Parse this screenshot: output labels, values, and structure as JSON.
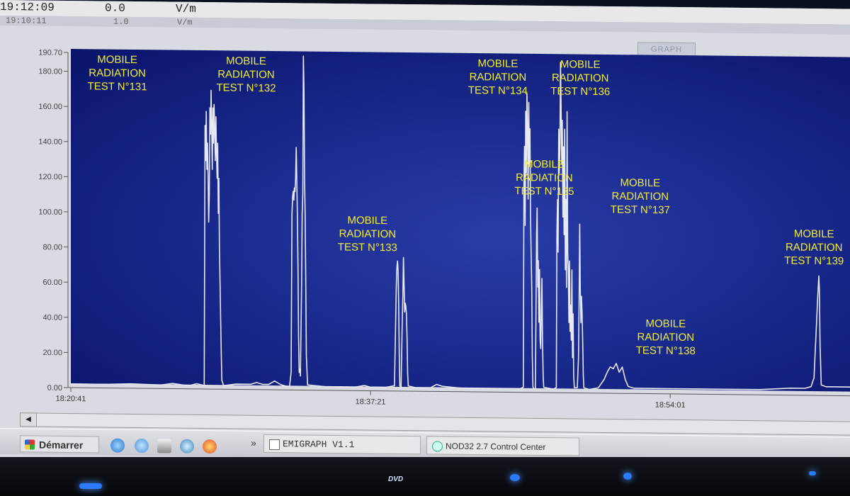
{
  "status": {
    "time": "19:12:09",
    "value": "0.0",
    "unit": "V/m",
    "shadow_time": "19:10:11",
    "shadow_value": "1.0",
    "shadow_unit": "V/m"
  },
  "graph_tab": "GRAPH",
  "colors": {
    "plot_background": "#1a2a8e",
    "trace": "#e6e8f2",
    "annotation": "#f2ef30"
  },
  "chart_data": {
    "type": "line",
    "xlabel": "",
    "ylabel": "",
    "ylim": [
      0,
      190.7
    ],
    "yticks": [
      "0.00",
      "20.00",
      "40.00",
      "60.00",
      "80.00",
      "100.00",
      "120.00",
      "140.00",
      "160.00",
      "180.00",
      "190.70"
    ],
    "xticks": [
      {
        "label": "18:20:41",
        "value": 0
      },
      {
        "label": "18:37:21",
        "value": 1000
      },
      {
        "label": "18:54:01",
        "value": 2000
      }
    ],
    "series": [
      {
        "points": [
          [
            0,
            2
          ],
          [
            100,
            2
          ],
          [
            200,
            2.5
          ],
          [
            300,
            2
          ],
          [
            340,
            3
          ],
          [
            380,
            2
          ],
          [
            400,
            2
          ],
          [
            420,
            3
          ],
          [
            445,
            2
          ],
          [
            448,
            150
          ],
          [
            450,
            130
          ],
          [
            452,
            158
          ],
          [
            454,
            125
          ],
          [
            456,
            140
          ],
          [
            458,
            120
          ],
          [
            460,
            95
          ],
          [
            462,
            110
          ],
          [
            464,
            160
          ],
          [
            466,
            145
          ],
          [
            468,
            170
          ],
          [
            470,
            150
          ],
          [
            472,
            125
          ],
          [
            474,
            160
          ],
          [
            476,
            140
          ],
          [
            478,
            162
          ],
          [
            480,
            148
          ],
          [
            482,
            130
          ],
          [
            484,
            155
          ],
          [
            486,
            135
          ],
          [
            488,
            120
          ],
          [
            490,
            140
          ],
          [
            492,
            100
          ],
          [
            494,
            120
          ],
          [
            496,
            80
          ],
          [
            498,
            60
          ],
          [
            500,
            40
          ],
          [
            502,
            20
          ],
          [
            504,
            5
          ],
          [
            510,
            2
          ],
          [
            550,
            3
          ],
          [
            600,
            3
          ],
          [
            620,
            4
          ],
          [
            640,
            3
          ],
          [
            660,
            3
          ],
          [
            680,
            5
          ],
          [
            700,
            3
          ],
          [
            720,
            2
          ],
          [
            730,
            2
          ],
          [
            735,
            10
          ],
          [
            738,
            100
          ],
          [
            740,
            110
          ],
          [
            742,
            113
          ],
          [
            744,
            108
          ],
          [
            746,
            115
          ],
          [
            748,
            113
          ],
          [
            750,
            120
          ],
          [
            752,
            138
          ],
          [
            754,
            120
          ],
          [
            756,
            100
          ],
          [
            758,
            70
          ],
          [
            760,
            30
          ],
          [
            762,
            10
          ],
          [
            764,
            12
          ],
          [
            766,
            8
          ],
          [
            770,
            60
          ],
          [
            772,
            100
          ],
          [
            774,
            112
          ],
          [
            776,
            190
          ],
          [
            778,
            170
          ],
          [
            780,
            120
          ],
          [
            782,
            100
          ],
          [
            784,
            60
          ],
          [
            786,
            20
          ],
          [
            790,
            3
          ],
          [
            850,
            2
          ],
          [
            900,
            2
          ],
          [
            950,
            2
          ],
          [
            980,
            3
          ],
          [
            1000,
            2
          ],
          [
            1050,
            2
          ],
          [
            1080,
            3
          ],
          [
            1084,
            40
          ],
          [
            1086,
            60
          ],
          [
            1088,
            70
          ],
          [
            1090,
            74
          ],
          [
            1092,
            68
          ],
          [
            1094,
            50
          ],
          [
            1096,
            20
          ],
          [
            1098,
            3
          ],
          [
            1102,
            2
          ],
          [
            1106,
            40
          ],
          [
            1108,
            55
          ],
          [
            1110,
            76
          ],
          [
            1112,
            60
          ],
          [
            1114,
            45
          ],
          [
            1116,
            50
          ],
          [
            1118,
            48
          ],
          [
            1120,
            44
          ],
          [
            1122,
            30
          ],
          [
            1124,
            10
          ],
          [
            1126,
            3
          ],
          [
            1150,
            2
          ],
          [
            1200,
            2
          ],
          [
            1220,
            4
          ],
          [
            1240,
            3
          ],
          [
            1300,
            2
          ],
          [
            1400,
            2
          ],
          [
            1450,
            2
          ],
          [
            1500,
            2
          ],
          [
            1510,
            3
          ],
          [
            1512,
            120
          ],
          [
            1514,
            140
          ],
          [
            1516,
            95
          ],
          [
            1518,
            160
          ],
          [
            1520,
            125
          ],
          [
            1522,
            170
          ],
          [
            1524,
            150
          ],
          [
            1526,
            110
          ],
          [
            1528,
            165
          ],
          [
            1530,
            130
          ],
          [
            1532,
            150
          ],
          [
            1534,
            100
          ],
          [
            1536,
            80
          ],
          [
            1538,
            60
          ],
          [
            1540,
            20
          ],
          [
            1542,
            3
          ],
          [
            1546,
            2
          ],
          [
            1550,
            2
          ],
          [
            1552,
            40
          ],
          [
            1554,
            90
          ],
          [
            1556,
            105
          ],
          [
            1558,
            60
          ],
          [
            1560,
            75
          ],
          [
            1562,
            40
          ],
          [
            1564,
            70
          ],
          [
            1566,
            30
          ],
          [
            1568,
            25
          ],
          [
            1570,
            45
          ],
          [
            1572,
            65
          ],
          [
            1574,
            30
          ],
          [
            1576,
            10
          ],
          [
            1578,
            3
          ],
          [
            1610,
            2
          ],
          [
            1620,
            3
          ],
          [
            1622,
            90
          ],
          [
            1624,
            110
          ],
          [
            1626,
            80
          ],
          [
            1628,
            150
          ],
          [
            1630,
            125
          ],
          [
            1632,
            140
          ],
          [
            1634,
            188
          ],
          [
            1636,
            160
          ],
          [
            1638,
            130
          ],
          [
            1640,
            155
          ],
          [
            1642,
            100
          ],
          [
            1644,
            140
          ],
          [
            1646,
            90
          ],
          [
            1648,
            150
          ],
          [
            1650,
            70
          ],
          [
            1652,
            110
          ],
          [
            1654,
            60
          ],
          [
            1656,
            160
          ],
          [
            1658,
            80
          ],
          [
            1660,
            70
          ],
          [
            1662,
            40
          ],
          [
            1664,
            75
          ],
          [
            1666,
            35
          ],
          [
            1668,
            50
          ],
          [
            1670,
            30
          ],
          [
            1672,
            70
          ],
          [
            1674,
            20
          ],
          [
            1676,
            45
          ],
          [
            1678,
            10
          ],
          [
            1680,
            3
          ],
          [
            1690,
            3
          ],
          [
            1694,
            20
          ],
          [
            1696,
            50
          ],
          [
            1698,
            96
          ],
          [
            1700,
            60
          ],
          [
            1702,
            40
          ],
          [
            1704,
            55
          ],
          [
            1706,
            45
          ],
          [
            1708,
            30
          ],
          [
            1710,
            10
          ],
          [
            1712,
            3
          ],
          [
            1730,
            2
          ],
          [
            1760,
            3
          ],
          [
            1780,
            8
          ],
          [
            1790,
            12
          ],
          [
            1800,
            15
          ],
          [
            1810,
            14
          ],
          [
            1820,
            17
          ],
          [
            1830,
            12
          ],
          [
            1840,
            15
          ],
          [
            1850,
            8
          ],
          [
            1860,
            4
          ],
          [
            1880,
            3
          ],
          [
            2000,
            3
          ],
          [
            2100,
            3
          ],
          [
            2200,
            3
          ],
          [
            2300,
            3
          ],
          [
            2400,
            4
          ],
          [
            2450,
            4
          ],
          [
            2470,
            5
          ],
          [
            2480,
            10
          ],
          [
            2484,
            25
          ],
          [
            2488,
            40
          ],
          [
            2492,
            55
          ],
          [
            2496,
            68
          ],
          [
            2498,
            60
          ],
          [
            2500,
            30
          ],
          [
            2504,
            6
          ],
          [
            2520,
            5
          ],
          [
            2600,
            5
          ]
        ]
      }
    ],
    "xlim": [
      0,
      2600
    ],
    "annotations": [
      {
        "lines": [
          "MOBILE",
          "RADIATION",
          "TEST N°131"
        ],
        "x": 155,
        "y": 185
      },
      {
        "lines": [
          "MOBILE",
          "RADIATION",
          "TEST N°132"
        ],
        "x": 585,
        "y": 185
      },
      {
        "lines": [
          "MOBILE",
          "RADIATION",
          "TEST N°133"
        ],
        "x": 990,
        "y": 95
      },
      {
        "lines": [
          "MOBILE",
          "RADIATION",
          "TEST N°134"
        ],
        "x": 1425,
        "y": 185
      },
      {
        "lines": [
          "MOBILE",
          "RADIATION",
          "TEST N°135"
        ],
        "x": 1580,
        "y": 128
      },
      {
        "lines": [
          "MOBILE",
          "RADIATION",
          "TEST N°136"
        ],
        "x": 1700,
        "y": 185
      },
      {
        "lines": [
          "MOBILE",
          "RADIATION",
          "TEST N°137"
        ],
        "x": 1900,
        "y": 118
      },
      {
        "lines": [
          "MOBILE",
          "RADIATION",
          "TEST N°138"
        ],
        "x": 1985,
        "y": 38
      },
      {
        "lines": [
          "MOBILE",
          "RADIATION",
          "TEST N°139"
        ],
        "x": 2480,
        "y": 90
      }
    ]
  },
  "taskbar": {
    "start_label": "Démarrer",
    "quicklaunch_icons": [
      "ie-icon",
      "outlook-icon",
      "trash-icon",
      "network-icon",
      "firefox-icon"
    ],
    "tasks": [
      "EMIGRAPH V1.1",
      "NOD32 2.7 Control Center"
    ]
  },
  "bezel": {
    "dvd_label": "DVD"
  }
}
